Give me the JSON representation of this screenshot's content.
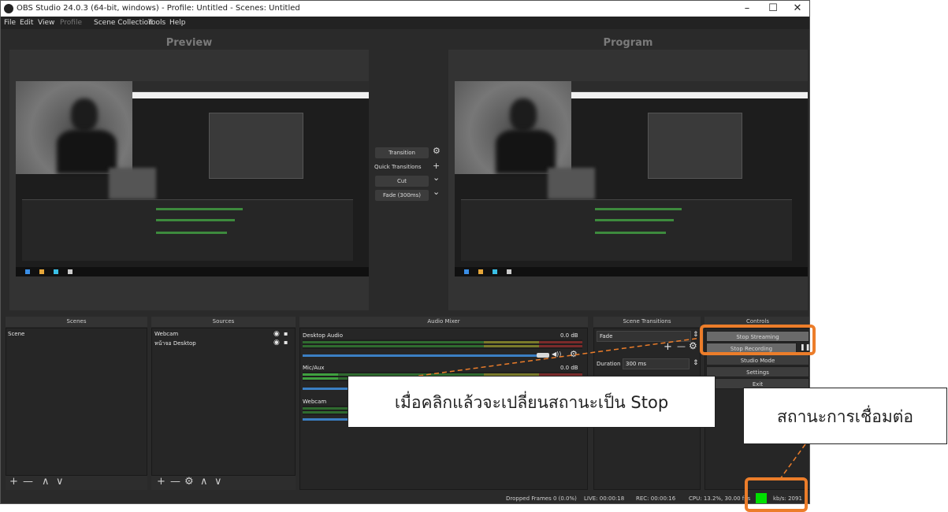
{
  "window": {
    "title": "OBS Studio 24.0.3 (64-bit, windows) - Profile: Untitled - Scenes: Untitled",
    "minimize": "–",
    "maximize": "☐",
    "close": "✕"
  },
  "menu": [
    "File",
    "Edit",
    "View",
    "Profile",
    "Scene Collection",
    "Tools",
    "Help"
  ],
  "preview_label": "Preview",
  "program_label": "Program",
  "transitions": {
    "transition_btn": "Transition",
    "quick_transitions": "Quick Transitions",
    "cut_btn": "Cut",
    "fade_btn": "Fade (300ms)",
    "gear_glyph": "⚙",
    "plus_glyph": "+",
    "chevron_glyph": "⌄"
  },
  "docks": {
    "scenes": {
      "title": "Scenes",
      "items": [
        "Scene"
      ],
      "footer": [
        "+",
        "—",
        "∧",
        "∨"
      ]
    },
    "sources": {
      "title": "Sources",
      "items": [
        "Webcam",
        "หน้าจอ Desktop"
      ],
      "footer": [
        "+",
        "—",
        "⚙",
        "∧",
        "∨"
      ]
    },
    "audio_mixer": {
      "title": "Audio Mixer",
      "channels": [
        {
          "name": "Desktop Audio",
          "db": "0.0 dB"
        },
        {
          "name": "Mic/Aux",
          "db": "0.0 dB"
        },
        {
          "name": "Webcam",
          "db": ""
        }
      ],
      "speaker_glyph": "◀))",
      "gear_glyph": "⚙"
    },
    "scene_transitions": {
      "title": "Scene Transitions",
      "selected": "Fade",
      "duration_label": "Duration",
      "duration_value": "300 ms",
      "plus": "+",
      "minus": "—",
      "gear": "⚙"
    },
    "controls": {
      "title": "Controls",
      "buttons": [
        "Stop Streaming",
        "Stop Recording",
        "Studio Mode",
        "Settings",
        "Exit"
      ],
      "pause_glyph": "❚❚"
    }
  },
  "status": {
    "dropped_frames": "Dropped Frames 0 (0.0%)",
    "live": "LIVE: 00:00:18",
    "rec": "REC: 00:00:16",
    "cpu": "CPU: 13.2%, 30.00 fps",
    "kbps": "kb/s: 2091",
    "indicator_color": "#00e000"
  },
  "annotations": {
    "callout_main": "เมื่อคลิกแล้วจะเปลี่ยนสถานะเป็น Stop",
    "callout_status": "สถานะการเชื่อมต่อ",
    "accent_color": "#ec7d2a"
  }
}
